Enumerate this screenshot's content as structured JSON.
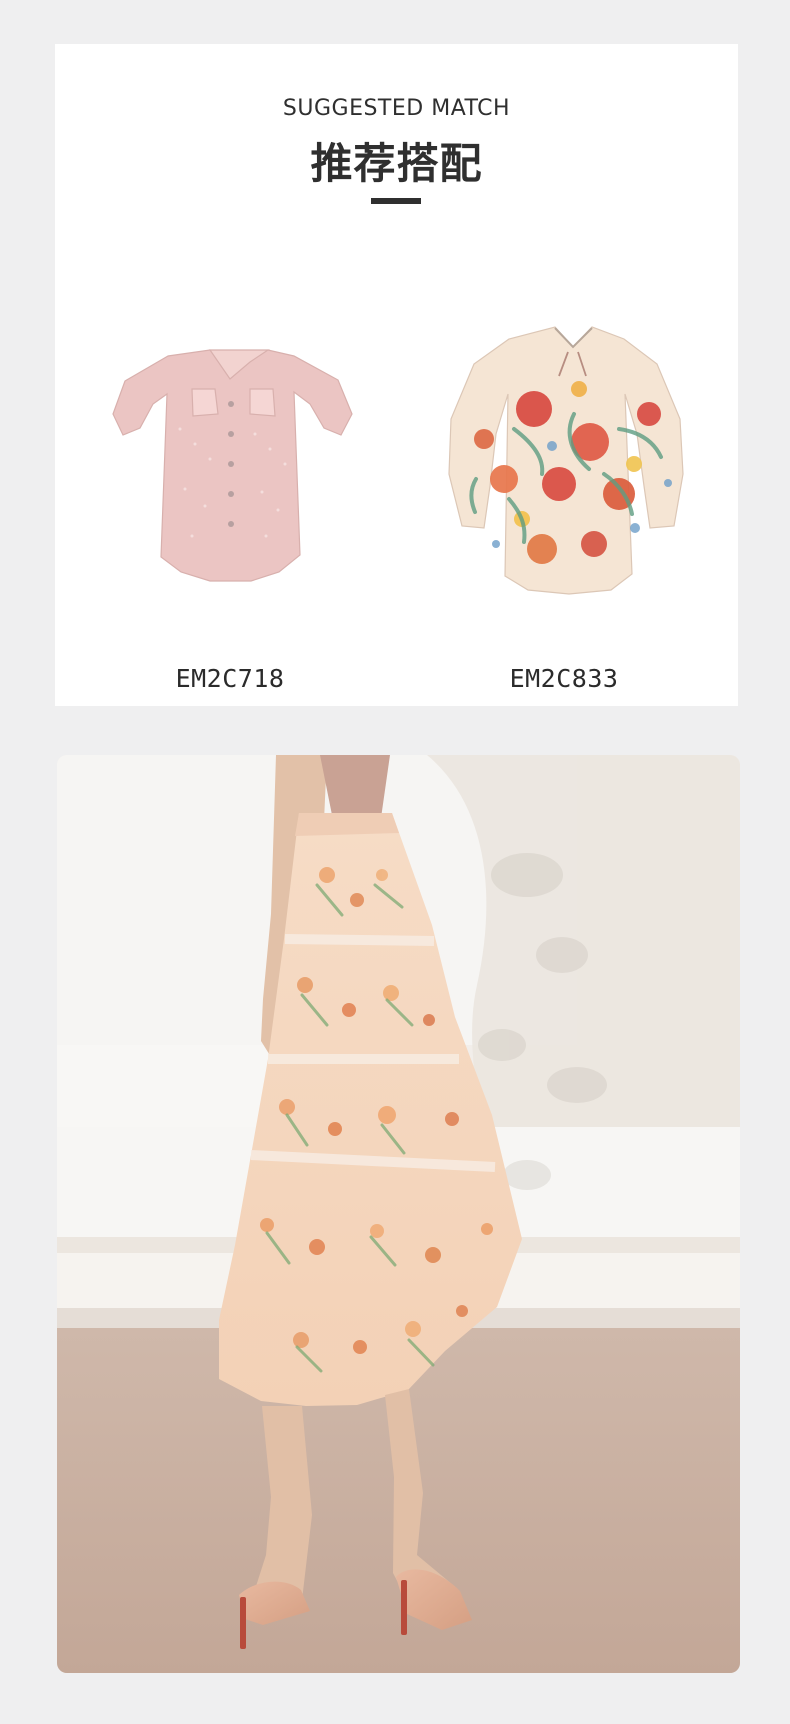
{
  "header": {
    "subtitle_en": "SUGGESTED MATCH",
    "title_cn": "推荐搭配"
  },
  "products": [
    {
      "code": "EM2C718",
      "icon": "pink-blouse-icon"
    },
    {
      "code": "EM2C833",
      "icon": "floral-blouse-icon"
    }
  ],
  "colors": {
    "page_bg": "#efeff0",
    "card_bg": "#ffffff",
    "text_dark": "#2f2f2f",
    "blouse_pink": "#ebc5c3",
    "floral_base": "#f5e5d4",
    "skirt_peach": "#f4d6bb"
  }
}
